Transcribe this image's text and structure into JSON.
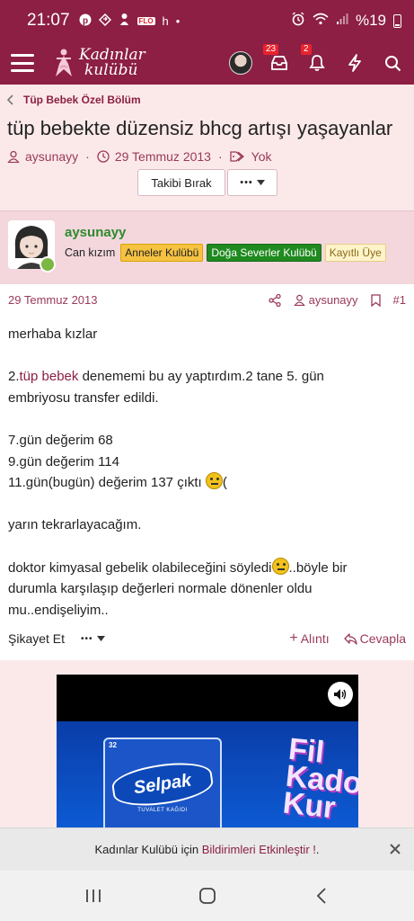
{
  "status_bar": {
    "time": "21:07",
    "left_icons": [
      "pinterest-icon",
      "transfer-icon",
      "baby-icon",
      "flo-icon",
      "h-icon",
      "dot-icon"
    ],
    "flo_label": "FLO",
    "h_label": "h",
    "battery": "%19"
  },
  "header": {
    "logo_line1": "Kadınlar",
    "logo_line2": "kulübü",
    "messages_badge": "23",
    "alerts_badge": "2",
    "accent": "#8c1f43"
  },
  "breadcrumb": {
    "label": "Tüp Bebek Özel Bölüm"
  },
  "thread": {
    "title": "tüp bebekte düzensiz bhcg artışı yaşayanlar",
    "author": "aysunayy",
    "date": "29 Temmuz 2013",
    "tags": "Yok",
    "follow_label": "Takibi Bırak",
    "more_label": "•••"
  },
  "post": {
    "username": "aysunayy",
    "user_title": "Can kızım",
    "badges": [
      "Anneler Kulübü",
      "Doğa Severler Kulübü",
      "Kayıtlı Üye"
    ],
    "date": "29 Temmuz 2013",
    "author": "aysunayy",
    "number": "#1",
    "lines": {
      "l1": "merhaba kızlar",
      "l2_pre": "2.",
      "l2_link": "tüp bebek",
      "l2_post": " denememi bu ay yaptırdım.2 tane 5. gün",
      "l3": "embriyosu transfer edildi.",
      "l4": "7.gün değerim 68",
      "l5": "9.gün değerim 114",
      "l6": "11.gün(bugün) değerim 137 çıktı ",
      "l6_after": "(",
      "l7": "yarın tekrarlayacağım.",
      "l8": "doktor kimyasal gebelik olabileceğini söyledi",
      "l8_after": "..böyle bir",
      "l9": "durumla karşılaşıp değerleri normale dönenler oldu",
      "l10": "mu..endişeliyim.."
    },
    "report_label": "Şikayet Et",
    "more_label": "•••",
    "quote_label": "Alıntı",
    "reply_label": "Cevapla"
  },
  "ad": {
    "brand": "Selpak",
    "sub": "TUVALET KAĞIDI",
    "count": "32",
    "film_text": "Fil\nKado\nKur"
  },
  "notification": {
    "pre": "Kadınlar Kulübü için ",
    "link": "Bildirimleri Etkinleştir !",
    "post": "."
  }
}
